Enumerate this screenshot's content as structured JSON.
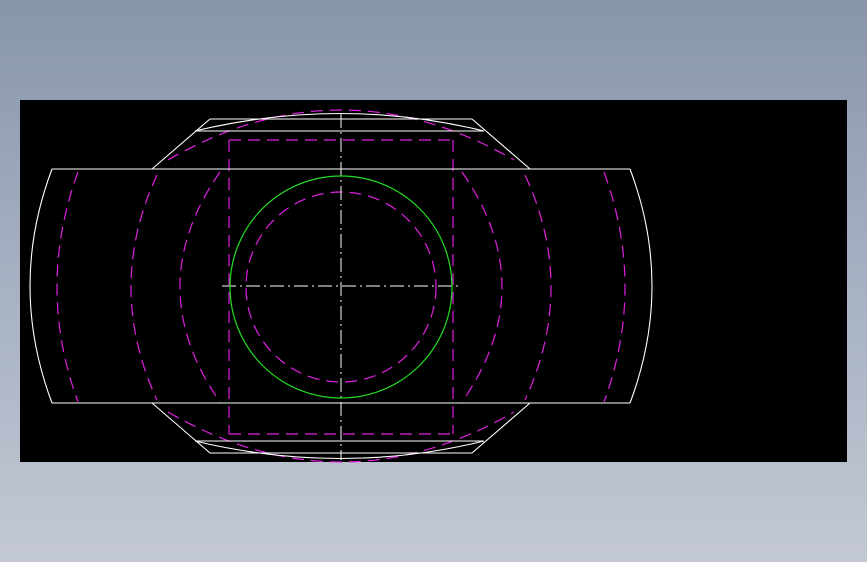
{
  "canvas": {
    "background": "#000000",
    "page_gradient": [
      "#8795ab",
      "#c3c8d4"
    ]
  },
  "colors": {
    "outline": "#ffffff",
    "hidden": "#e020e0",
    "circle": "#22dd22",
    "centerline": "#ffffff"
  }
}
